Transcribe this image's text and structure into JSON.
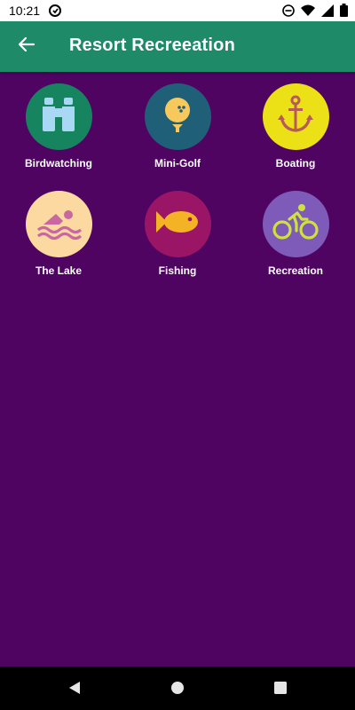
{
  "status_bar": {
    "time": "10:21",
    "icons": [
      "circle-app-icon",
      "do-not-disturb-icon",
      "wifi-icon",
      "cellular-icon",
      "battery-icon"
    ]
  },
  "app_bar": {
    "title": "Resort Recreeation",
    "back_icon": "arrow-left-icon",
    "color": "#1e8a67"
  },
  "tiles": [
    {
      "label": "Birdwatching",
      "icon": "binoculars-icon",
      "circle_color": "#16855f",
      "icon_color": "#a9d8f5"
    },
    {
      "label": "Mini-Golf",
      "icon": "golf-ball-icon",
      "circle_color": "#1f5f78",
      "icon_color": "#f7c95d"
    },
    {
      "label": "Boating",
      "icon": "anchor-icon",
      "circle_color": "#ece016",
      "icon_color": "#b75a5a"
    },
    {
      "label": "The Lake",
      "icon": "swimmer-icon",
      "circle_color": "#fbd9a1",
      "icon_color": "#c867a0"
    },
    {
      "label": "Fishing",
      "icon": "fish-icon",
      "circle_color": "#9b1567",
      "icon_color": "#f4b325"
    },
    {
      "label": "Recreation",
      "icon": "cyclist-icon",
      "circle_color": "#7e5ab9",
      "icon_color": "#cfe23b"
    }
  ],
  "nav_bar": {
    "icons": [
      "back-triangle-icon",
      "home-circle-icon",
      "recents-square-icon"
    ]
  },
  "colors": {
    "background": "#4f0462",
    "app_bar": "#1e8a67"
  }
}
